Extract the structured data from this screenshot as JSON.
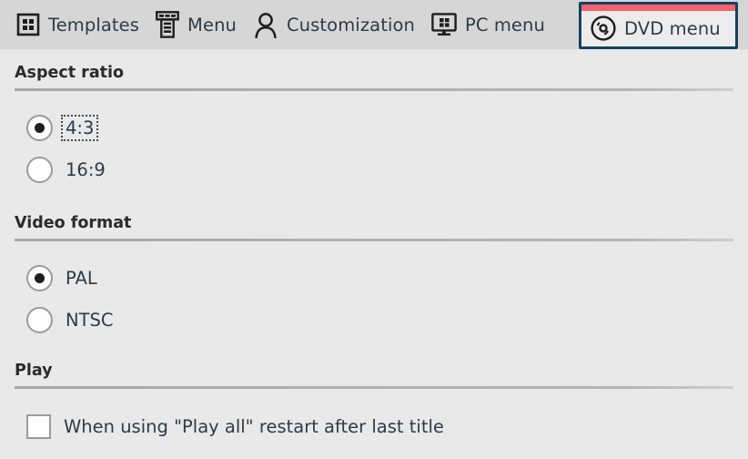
{
  "toolbar": {
    "tabs": [
      {
        "label": "Templates",
        "icon": "grid-icon",
        "active": false
      },
      {
        "label": "Menu",
        "icon": "layout-icon",
        "active": false
      },
      {
        "label": "Customization",
        "icon": "person-icon",
        "active": false
      },
      {
        "label": "PC menu",
        "icon": "monitor-icon",
        "active": false
      },
      {
        "label": "DVD menu",
        "icon": "disc-icon",
        "active": true
      }
    ],
    "active_tab_accent_color": "#f4636a",
    "active_tab_border_color": "#124264",
    "background_color": "#d6d6d6"
  },
  "sections": [
    {
      "title": "Aspect ratio",
      "options": [
        {
          "label": "4:3",
          "selected": true,
          "focused": true
        },
        {
          "label": "16:9",
          "selected": false,
          "focused": false
        }
      ]
    },
    {
      "title": "Video format",
      "options": [
        {
          "label": "PAL",
          "selected": true,
          "focused": false
        },
        {
          "label": "NTSC",
          "selected": false,
          "focused": false
        }
      ]
    },
    {
      "title": "Play",
      "checkbox": {
        "label": "When using \"Play all\" restart after last title",
        "checked": false
      }
    }
  ]
}
